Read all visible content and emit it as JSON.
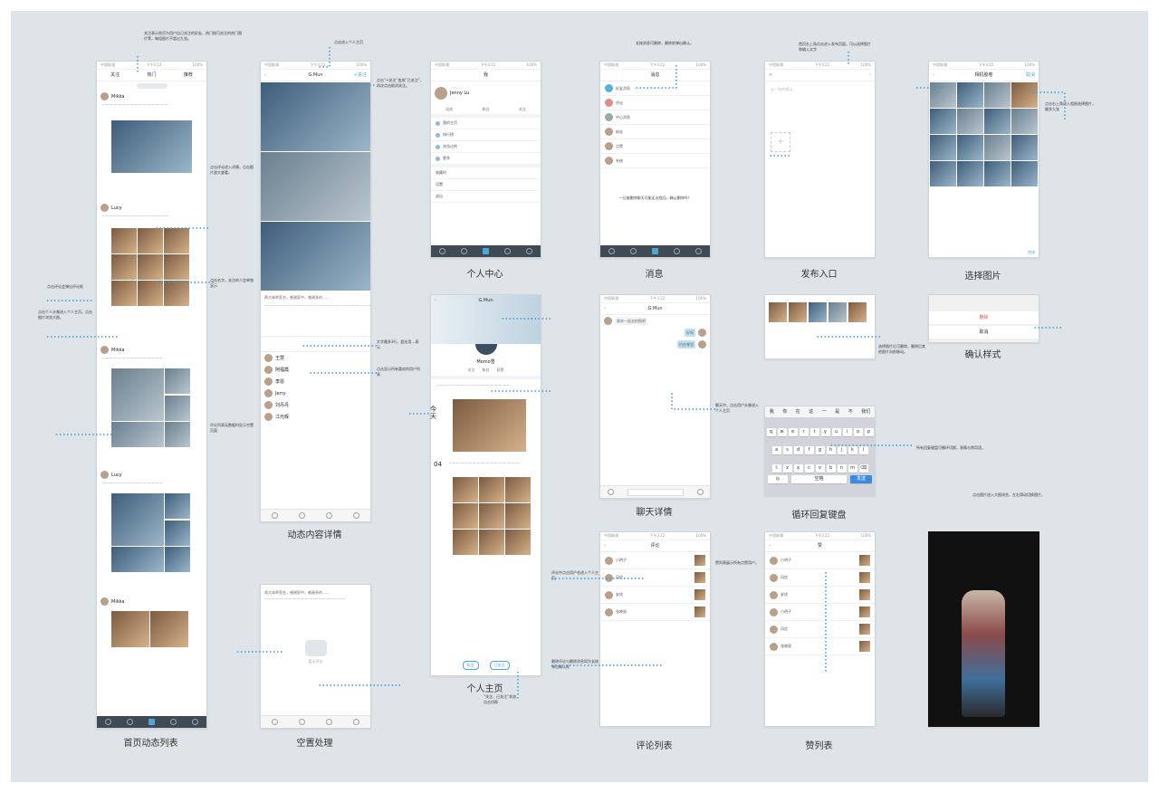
{
  "board_title": "",
  "captions": {
    "home": "首页动态列表",
    "detail": "动态内容详情",
    "empty": "空置处理",
    "profile_center": "个人中心",
    "homepage": "个人主页",
    "messages": "消息",
    "chat": "聊天详情",
    "comments": "评论列表",
    "publish": "发布入口",
    "keyboard": "循环回复键盘",
    "likes": "赞列表",
    "select_photo": "选择图片",
    "confirm": "确认样式"
  },
  "status_bar": {
    "carrier": "中国联通",
    "time": "下午3:22",
    "battery": "100%"
  },
  "home": {
    "tabs": [
      "关注",
      "热门",
      "推荐"
    ],
    "users": [
      "Mikka",
      "Lucy",
      "Mikka",
      "Lucy",
      "Mikka"
    ]
  },
  "detail": {
    "title": "G.Mun",
    "follow": "+关注",
    "text": "两大体师签名，感谢家中，感谢多的……",
    "commenters": [
      "王慧",
      "阿福霞",
      "李恩",
      "Jerry",
      "刘丹丹",
      "江光辉"
    ]
  },
  "empty": {
    "text": "两大体师签名，感谢家中，感谢多的……",
    "placeholder": "暂无评论"
  },
  "profile_center": {
    "title": "我",
    "user": "Jenny Lu",
    "stats": [
      "动态",
      "粉丝",
      "关注"
    ],
    "menu": [
      "我的主页",
      "排行榜",
      "浏览过的",
      "更多",
      "收藏的",
      "设置",
      "退出"
    ]
  },
  "homepage": {
    "title": "G.Mun",
    "name": "Momo雪",
    "stats": [
      "关注",
      "粉丝",
      "获赞"
    ],
    "date_day": "今天",
    "date_num": "04",
    "buttons": [
      "私信",
      "已关注"
    ]
  },
  "messages": {
    "title": "消息",
    "items": [
      "好友消息",
      "评论",
      "中心消息",
      "粉丝",
      "点赞",
      "系统"
    ],
    "note": "一旦被删除聊天可能无法找回，确认删除吗？"
  },
  "chat": {
    "title": "G.Mun",
    "bubbles": [
      "周末一起去拍照吧",
      "好呀",
      "约在哪里"
    ]
  },
  "comments": {
    "title": "评论",
    "names": [
      "小明子",
      "风信",
      "安欣",
      "张晓丽"
    ]
  },
  "publish": {
    "title": "发布入口",
    "placeholder": "这一刻的想法..."
  },
  "keyboard": {
    "suggest": [
      "我",
      "你",
      "在",
      "这",
      "一",
      "是",
      "不",
      "我们"
    ],
    "row1": [
      "q",
      "w",
      "e",
      "r",
      "t",
      "y",
      "u",
      "i",
      "o",
      "p"
    ],
    "row2": [
      "a",
      "s",
      "d",
      "f",
      "g",
      "h",
      "j",
      "k",
      "l"
    ],
    "row3": [
      "z",
      "x",
      "c",
      "v",
      "b",
      "n",
      "m"
    ],
    "space": "空格",
    "send": "发送"
  },
  "likes": {
    "title": "赞",
    "names": [
      "小明子",
      "风信",
      "安欣",
      "小明子",
      "风信",
      "张晓丽"
    ]
  },
  "select_photo": {
    "title": "相机胶卷",
    "cancel": "取消",
    "done": "完成"
  },
  "confirm": {
    "delete": "删除",
    "cancel": "取消"
  },
  "notes": {
    "n1": "关注表示首页为用户自己关注的好友，热门指可关注的热门图片等，每组图片不超过九张。",
    "n2": "点击进入个人主页",
    "n3": "点击“+关注”变成“已关注”，再次点击取消关注。",
    "n4": "点击评论进入详情，点击图片放大查看。",
    "n5": "点击评论会弹出评论框",
    "n6": "点击个人头像进入个人主页。点击图片浏览大图。",
    "n7": "文字最多3行，超出用...表示",
    "n8": "点击显示所有喜欢的用户列表",
    "n9": "点击名字，关注的人会单独显示",
    "n10": "评论中点击用户名进入个人主页。",
    "n11": "删除评论与删除消息同为长按弹出确认框",
    "n12": "首页右上角点击进入发布页面，可以选择图片和输入文字",
    "n13": "点击右上角进入相册选择图片，最多九张",
    "n14": "聊天中，点击用户头像进入个人主页",
    "n15": "所有回复键盘可循环切换，表情与常用语。",
    "n16": "点击图片进入大图浏览，左右滑动切换图片。",
    "n17": "选择图片后可删除，删除后其他图片向前移动。",
    "n18": "“关注、已关注”状态点击切换",
    "n19": "评论列表无数据时显示空置页面",
    "n20": "长按消息可删除，删除前弹出确认。",
    "n21": "赞列表展示所有点赞用户。"
  }
}
